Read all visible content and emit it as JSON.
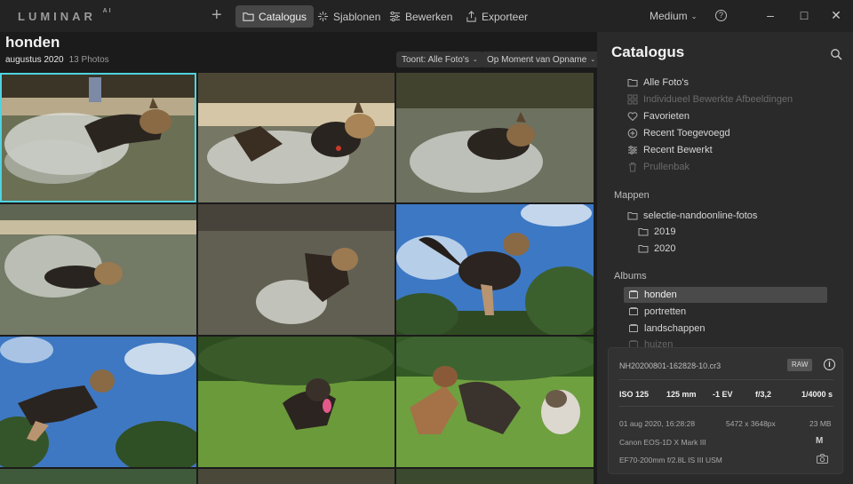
{
  "app": {
    "logo": "LUMINAR",
    "logo_sup": "AI"
  },
  "nav": {
    "add_label": "+",
    "catalogus": "Catalogus",
    "sjablonen": "Sjablonen",
    "bewerken": "Bewerken",
    "exporteer": "Exporteer",
    "size": "Medium",
    "help": "?"
  },
  "header": {
    "title": "honden",
    "date": "augustus 2020",
    "count": "13 Photos",
    "filter": "Toont: Alle Foto's",
    "sort": "Op Moment van Opname"
  },
  "colors": {
    "accent": "#4fd3e0",
    "selected_row": "#4a4a4a"
  },
  "panel": {
    "title": "Catalogus",
    "catalog_items": [
      {
        "label": "Alle Foto's",
        "icon": "folder-icon",
        "dim": false
      },
      {
        "label": "Individueel Bewerkte Afbeeldingen",
        "icon": "grid-icon",
        "dim": true
      },
      {
        "label": "Favorieten",
        "icon": "heart-icon",
        "dim": false
      },
      {
        "label": "Recent Toegevoegd",
        "icon": "plus-circle-icon",
        "dim": false
      },
      {
        "label": "Recent Bewerkt",
        "icon": "sliders-icon",
        "dim": false
      },
      {
        "label": "Prullenbak",
        "icon": "trash-icon",
        "dim": true
      }
    ],
    "mappen_label": "Mappen",
    "folders": [
      "selectie-nandoonline-fotos",
      "2019",
      "2020"
    ],
    "albums_label": "Albums",
    "albums": [
      "honden",
      "portretten",
      "landschappen",
      "huizen"
    ]
  },
  "info": {
    "filename": "NH20200801-162828-10.cr3",
    "raw": "RAW",
    "iso": "ISO 125",
    "focal": "125 mm",
    "ev": "-1 EV",
    "aperture": "f/3,2",
    "shutter": "1/4000 s",
    "datetime": "01 aug 2020, 16:28:28",
    "dimensions": "5472 x 3648px",
    "size": "23 MB",
    "camera": "Canon EOS-1D X Mark III",
    "camera_mode": "M",
    "lens": "EF70-200mm f/2.8L IS III USM"
  }
}
